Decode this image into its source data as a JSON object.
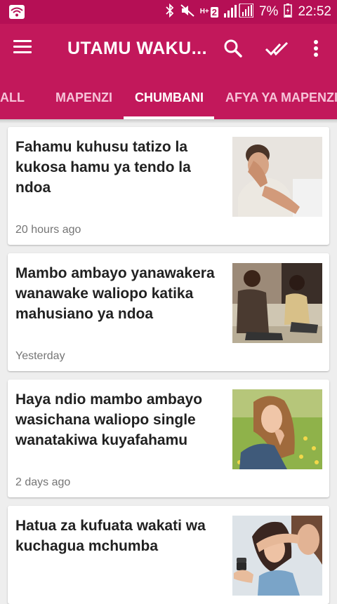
{
  "status_bar": {
    "battery_percent": "7%",
    "time": "22:52",
    "network_label": "H+",
    "sim_label": "2",
    "icons": [
      "wifi-icon",
      "bluetooth-icon",
      "mute-icon",
      "signal-icon",
      "battery-icon"
    ]
  },
  "app_bar": {
    "title": "UTAMU WAKU...",
    "icons": [
      "menu-icon",
      "search-icon",
      "mark-read-icon",
      "more-vert-icon"
    ]
  },
  "tabs": [
    {
      "label": "ALL"
    },
    {
      "label": "MAPENZI"
    },
    {
      "label": "CHUMBANI"
    },
    {
      "label": "AFYA YA MAPENZI"
    }
  ],
  "active_tab": "CHUMBANI",
  "colors": {
    "primary": "#c2185b",
    "status_bar": "#b50f55",
    "tab_inactive": "#f6c3d8"
  },
  "articles": [
    {
      "title": "Fahamu kuhusu tatizo la kukosa hamu ya tendo la ndoa",
      "time": "20 hours ago",
      "image": "stressed-man-photo"
    },
    {
      "title": "Mambo ambayo yanawakera wanawake waliopo katika mahusiano ya ndoa",
      "time": "Yesterday",
      "image": "couple-on-couch-photo"
    },
    {
      "title": "Haya ndio mambo ambayo wasichana waliopo single wanatakiwa kuyafahamu",
      "time": "2 days ago",
      "image": "woman-in-field-photo"
    },
    {
      "title": "Hatua za kufuata wakati wa kuchagua mchumba",
      "time": "",
      "image": "proposal-ring-photo"
    }
  ]
}
